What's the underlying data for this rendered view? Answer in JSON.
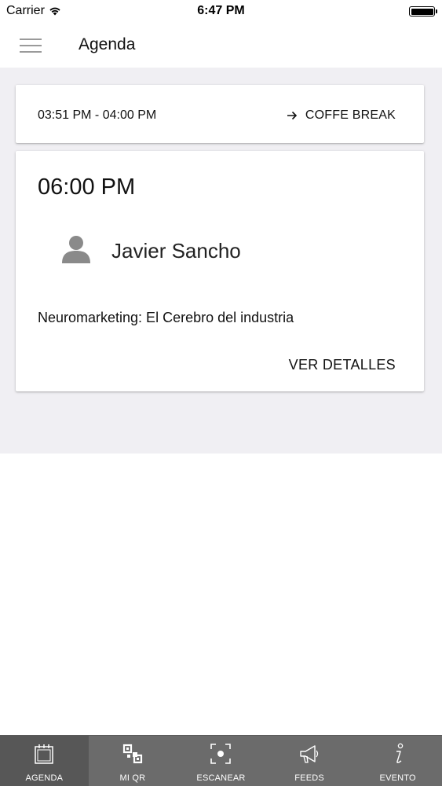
{
  "status_bar": {
    "carrier": "Carrier",
    "time": "6:47 PM",
    "wifi_icon": "wifi-icon",
    "battery_level": 1.0
  },
  "app_bar": {
    "title": "Agenda",
    "menu_icon": "hamburger-menu-icon"
  },
  "agenda": {
    "break_item": {
      "time_range": "03:51 PM - 04:00 PM",
      "title": "COFFE BREAK",
      "icon": "arrow-right-icon"
    },
    "session": {
      "time": "06:00 PM",
      "speaker_name": "Javier Sancho",
      "speaker_icon": "user-avatar-icon",
      "title": "Neuromarketing: El Cerebro del industria",
      "details_label": "VER DETALLES"
    }
  },
  "tab_bar": {
    "tabs": [
      {
        "label": "AGENDA",
        "icon": "calendar-icon",
        "active": true
      },
      {
        "label": "MI QR",
        "icon": "qr-code-icon",
        "active": false
      },
      {
        "label": "ESCANEAR",
        "icon": "scan-icon",
        "active": false
      },
      {
        "label": "FEEDS",
        "icon": "megaphone-icon",
        "active": false
      },
      {
        "label": "EVENTO",
        "icon": "info-icon",
        "active": false
      }
    ]
  },
  "colors": {
    "content_background": "#f0eff3",
    "tab_bar_background": "#6b6b6b",
    "tab_active_background": "#575757",
    "avatar_gray": "#8a8a8a"
  }
}
